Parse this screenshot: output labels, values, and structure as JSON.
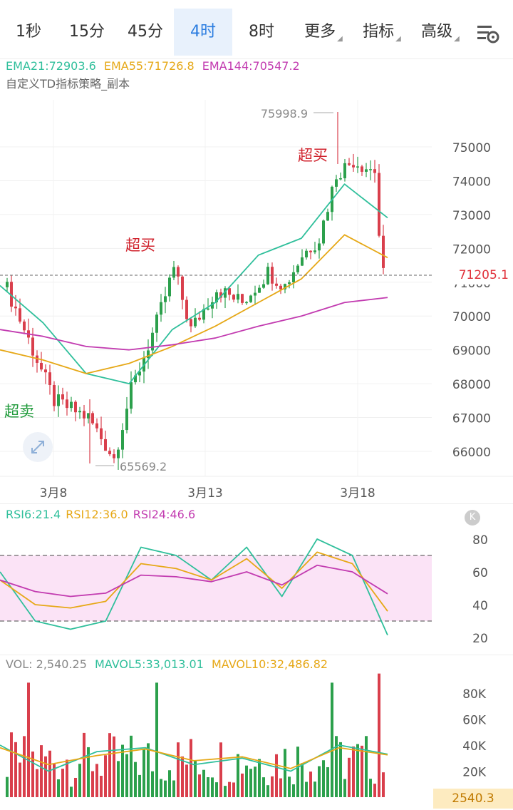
{
  "tabs": [
    {
      "label": "1秒",
      "active": false,
      "dropdown": false
    },
    {
      "label": "15分",
      "active": false,
      "dropdown": false
    },
    {
      "label": "45分",
      "active": false,
      "dropdown": false
    },
    {
      "label": "4时",
      "active": true,
      "dropdown": false
    },
    {
      "label": "8时",
      "active": false,
      "dropdown": false
    },
    {
      "label": "更多",
      "active": false,
      "dropdown": true
    },
    {
      "label": "指标",
      "active": false,
      "dropdown": true
    },
    {
      "label": "高级",
      "active": false,
      "dropdown": true
    }
  ],
  "settings_icon": "chart-settings-icon",
  "ema_legend": {
    "ema21": {
      "label": "EMA21:72903.6",
      "color": "#2fbf9b"
    },
    "ema55": {
      "label": "EMA55:71726.8",
      "color": "#e6a817"
    },
    "ema144": {
      "label": "EMA144:70547.2",
      "color": "#c23bb0"
    }
  },
  "strategy_label": "自定义TD指标策略_副本",
  "annotations": {
    "overbought": "超买",
    "oversold": "超卖",
    "high_label": "75998.9",
    "low_label": "65569.2"
  },
  "current_price": "71205.1",
  "price_axis": [
    "75000",
    "74000",
    "73000",
    "72000",
    "71000",
    "70000",
    "69000",
    "68000",
    "67000",
    "66000"
  ],
  "date_axis": [
    "3月8",
    "3月13",
    "3月18"
  ],
  "rsi_legend": {
    "rsi6": {
      "label": "RSI6:21.4",
      "color": "#2fbf9b"
    },
    "rsi12": {
      "label": "RSI12:36.0",
      "color": "#e6a817"
    },
    "rsi24": {
      "label": "RSI24:46.6",
      "color": "#c23bb0"
    }
  },
  "rsi_axis": [
    "80",
    "60",
    "40",
    "20"
  ],
  "vol_legend": {
    "vol": {
      "label": "VOL: 2,540.25",
      "color": "#888888"
    },
    "mavol5": {
      "label": "MAVOL5:33,013.01",
      "color": "#2fbf9b"
    },
    "mavol10": {
      "label": "MAVOL10:32,486.82",
      "color": "#e6a817"
    }
  },
  "vol_axis": [
    "80K",
    "60K",
    "40K",
    "20K"
  ],
  "current_volume": "2540.3",
  "colors": {
    "up": "#2ca04c",
    "down": "#d93f4c",
    "band": "#fbe3f6"
  },
  "chart_data": [
    {
      "type": "candlestick",
      "title": "",
      "ylim": [
        65569.2,
        75998.9
      ],
      "x": [
        "3月8",
        "3月13",
        "3月18"
      ],
      "series": [
        {
          "name": "EMA21",
          "values": [
            70900,
            69800,
            68300,
            68000,
            69600,
            70400,
            71800,
            72300,
            73900,
            72903.6
          ]
        },
        {
          "name": "EMA55",
          "values": [
            69000,
            68700,
            68300,
            68600,
            69100,
            69700,
            70400,
            71100,
            72400,
            71726.8
          ]
        },
        {
          "name": "EMA144",
          "values": [
            69600,
            69400,
            69100,
            69000,
            69150,
            69350,
            69700,
            70000,
            70400,
            70547.2
          ]
        }
      ]
    },
    {
      "type": "line",
      "title": "",
      "ylim": [
        15,
        90
      ],
      "series": [
        {
          "name": "RSI6",
          "values": [
            60,
            30,
            25,
            30,
            75,
            70,
            55,
            75,
            45,
            80,
            70,
            21.4
          ]
        },
        {
          "name": "RSI12",
          "values": [
            55,
            40,
            38,
            42,
            65,
            62,
            55,
            68,
            50,
            72,
            65,
            36.0
          ]
        },
        {
          "name": "RSI24",
          "values": [
            55,
            48,
            45,
            47,
            58,
            57,
            54,
            60,
            52,
            64,
            60,
            46.6
          ]
        }
      ]
    },
    {
      "type": "bar",
      "title": "",
      "ylim": [
        0,
        95000
      ],
      "series": [
        {
          "name": "MAVOL5",
          "values": [
            40000,
            20000,
            35000,
            38000,
            25000,
            30000,
            20000,
            40000,
            33013.01
          ]
        },
        {
          "name": "MAVOL10",
          "values": [
            38000,
            25000,
            32000,
            37000,
            28000,
            31000,
            22000,
            38000,
            32486.82
          ]
        }
      ]
    }
  ]
}
